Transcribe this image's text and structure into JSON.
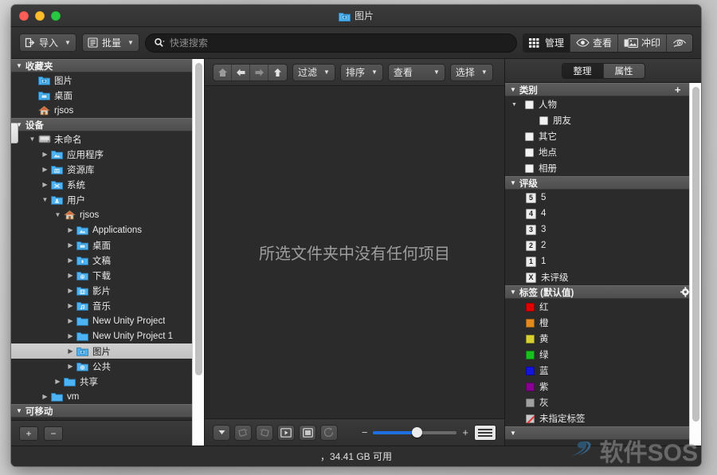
{
  "window": {
    "title": "图片",
    "title_icon": "photos-folder-icon",
    "traffic_lights": [
      "close",
      "minimize",
      "zoom"
    ]
  },
  "toolbar": {
    "import_label": "导入",
    "batch_label": "批量",
    "search_placeholder": "快速搜索",
    "modes": [
      {
        "label": "管理",
        "icon": "grid-icon",
        "active": true
      },
      {
        "label": "查看",
        "icon": "eye-icon",
        "active": false
      },
      {
        "label": "冲印",
        "icon": "print-photo-icon",
        "active": false
      },
      {
        "label": "",
        "icon": "eye-slash-icon",
        "active": false
      }
    ]
  },
  "sidebar": {
    "groups": [
      {
        "label": "收藏夹",
        "items": [
          {
            "label": "图片",
            "icon": "photos-folder-icon",
            "indent": 1,
            "twisty": "",
            "selected": false
          },
          {
            "label": "桌面",
            "icon": "desktop-folder-icon",
            "indent": 1,
            "twisty": "",
            "selected": false
          },
          {
            "label": "rjsos",
            "icon": "home-icon",
            "indent": 1,
            "twisty": "",
            "selected": false
          }
        ]
      },
      {
        "label": "设备",
        "items": [
          {
            "label": "未命名",
            "icon": "drive-icon",
            "indent": 1,
            "twisty": "down",
            "selected": false
          },
          {
            "label": "应用程序",
            "icon": "apps-folder-icon",
            "indent": 2,
            "twisty": "right",
            "selected": false
          },
          {
            "label": "资源库",
            "icon": "library-folder-icon",
            "indent": 2,
            "twisty": "right",
            "selected": false
          },
          {
            "label": "系统",
            "icon": "system-folder-icon",
            "indent": 2,
            "twisty": "right",
            "selected": false
          },
          {
            "label": "用户",
            "icon": "users-folder-icon",
            "indent": 2,
            "twisty": "down",
            "selected": false
          },
          {
            "label": "rjsos",
            "icon": "home-icon",
            "indent": 3,
            "twisty": "down",
            "selected": false
          },
          {
            "label": "Applications",
            "icon": "apps-folder-icon",
            "indent": 4,
            "twisty": "right",
            "selected": false
          },
          {
            "label": "桌面",
            "icon": "desktop-folder-icon",
            "indent": 4,
            "twisty": "right",
            "selected": false
          },
          {
            "label": "文稿",
            "icon": "documents-folder-icon",
            "indent": 4,
            "twisty": "right",
            "selected": false
          },
          {
            "label": "下载",
            "icon": "downloads-folder-icon",
            "indent": 4,
            "twisty": "right",
            "selected": false
          },
          {
            "label": "影片",
            "icon": "movies-folder-icon",
            "indent": 4,
            "twisty": "right",
            "selected": false
          },
          {
            "label": "音乐",
            "icon": "music-folder-icon",
            "indent": 4,
            "twisty": "right",
            "selected": false
          },
          {
            "label": "New Unity Project",
            "icon": "folder-icon",
            "indent": 4,
            "twisty": "right",
            "selected": false
          },
          {
            "label": "New Unity Project 1",
            "icon": "folder-icon",
            "indent": 4,
            "twisty": "right",
            "selected": false
          },
          {
            "label": "图片",
            "icon": "photos-folder-icon",
            "indent": 4,
            "twisty": "right",
            "selected": true
          },
          {
            "label": "公共",
            "icon": "public-folder-icon",
            "indent": 4,
            "twisty": "right",
            "selected": false
          },
          {
            "label": "共享",
            "icon": "folder-icon",
            "indent": 3,
            "twisty": "right",
            "selected": false
          },
          {
            "label": "vm",
            "icon": "folder-icon",
            "indent": 2,
            "twisty": "right",
            "selected": false
          }
        ]
      },
      {
        "label": "可移动",
        "items": []
      }
    ],
    "footer": {
      "add_label": "+",
      "remove_label": "−"
    }
  },
  "center": {
    "nav": [
      {
        "icon": "home-icon",
        "name": "home-button",
        "dim": true
      },
      {
        "icon": "arrow-left-icon",
        "name": "back-button",
        "dim": false
      },
      {
        "icon": "arrow-right-icon",
        "name": "forward-button",
        "dim": true
      },
      {
        "icon": "arrow-up-icon",
        "name": "up-button",
        "dim": false
      }
    ],
    "menus": [
      {
        "label": "过滤",
        "name": "filter-menu"
      },
      {
        "label": "排序",
        "name": "sort-menu"
      },
      {
        "label": "查看",
        "name": "view-menu",
        "wide": true
      },
      {
        "label": "选择",
        "name": "select-menu"
      }
    ],
    "empty_message": "所选文件夹中没有任何项目",
    "bottom_buttons": [
      {
        "icon": "chevron-down-icon",
        "name": "options-button",
        "dim": false
      },
      {
        "icon": "rotate-ccw-icon",
        "name": "rotate-left-button",
        "dim": true
      },
      {
        "icon": "rotate-cw-icon",
        "name": "rotate-right-button",
        "dim": true
      },
      {
        "icon": "slideshow-icon",
        "name": "slideshow-button",
        "dim": false
      },
      {
        "icon": "fullscreen-icon",
        "name": "fullscreen-button",
        "dim": false
      },
      {
        "icon": "refresh-icon",
        "name": "refresh-button",
        "dim": true
      }
    ],
    "zoom": {
      "minus": "−",
      "plus": "+",
      "value_percent": 52
    }
  },
  "right_panel": {
    "tabs": [
      {
        "label": "整理",
        "active": true
      },
      {
        "label": "属性",
        "active": false
      }
    ],
    "sections": [
      {
        "title": "类别",
        "title_icon": "chevron-down-icon",
        "actions": [
          "+",
          "−"
        ],
        "type": "checkbox",
        "items": [
          {
            "label": "人物",
            "indent": 1,
            "twisty": "down"
          },
          {
            "label": "朋友",
            "indent": 2,
            "twisty": ""
          },
          {
            "label": "其它",
            "indent": 1,
            "twisty": ""
          },
          {
            "label": "地点",
            "indent": 1,
            "twisty": ""
          },
          {
            "label": "相册",
            "indent": 1,
            "twisty": ""
          }
        ]
      },
      {
        "title": "评级",
        "title_icon": "chevron-down-icon",
        "actions": [],
        "type": "rating",
        "items": [
          {
            "box": "5",
            "label": "5"
          },
          {
            "box": "4",
            "label": "4"
          },
          {
            "box": "3",
            "label": "3"
          },
          {
            "box": "2",
            "label": "2"
          },
          {
            "box": "1",
            "label": "1"
          },
          {
            "box": "X",
            "label": "未评级"
          }
        ]
      },
      {
        "title": "标签 (默认值)",
        "title_icon": "chevron-down-icon",
        "actions": [
          "gear-icon"
        ],
        "type": "label",
        "items": [
          {
            "label": "红",
            "color": "#e00000"
          },
          {
            "label": "橙",
            "color": "#e08b20"
          },
          {
            "label": "黄",
            "color": "#d8d030"
          },
          {
            "label": "绿",
            "color": "#18c020"
          },
          {
            "label": "蓝",
            "color": "#1414e0"
          },
          {
            "label": "紫",
            "color": "#880090"
          },
          {
            "label": "灰",
            "color": "#a0a0a0"
          },
          {
            "label": "未指定标签",
            "color": "none"
          }
        ]
      }
    ]
  },
  "status_bar": {
    "text": "，34.41 GB 可用"
  },
  "watermark": {
    "text": "软件SOS",
    "logo": "swoosh-logo-icon"
  },
  "colors": {
    "accent": "#1f6fe0",
    "folder_blue": "#4cb3f5",
    "window_bg": "#2b2b2b",
    "group_header": "#565656"
  }
}
